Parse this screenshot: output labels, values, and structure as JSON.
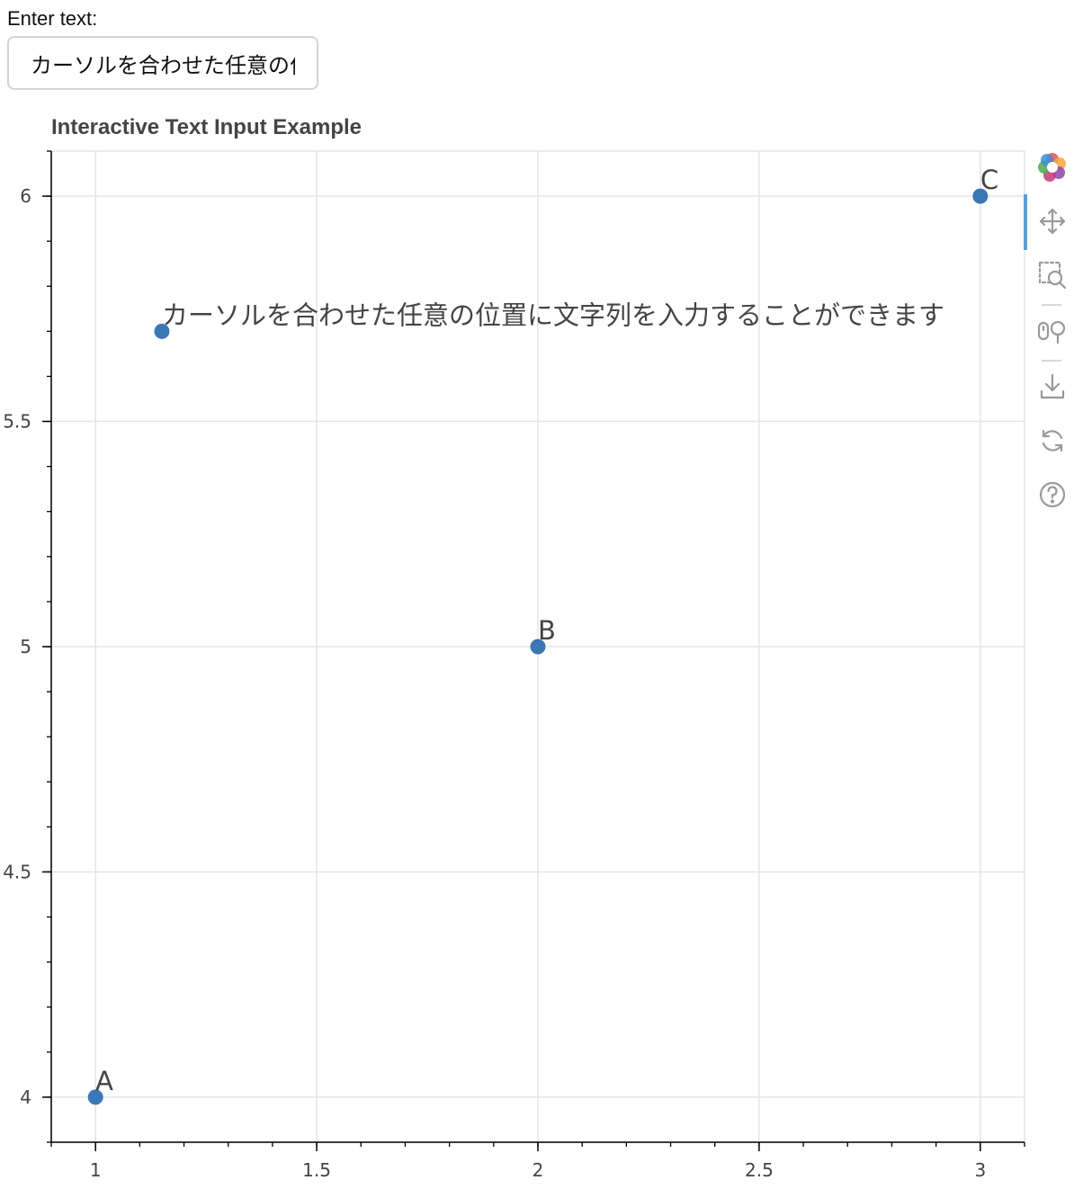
{
  "input": {
    "label": "Enter text:",
    "value": "カーソルを合わせた任意の位置に文字列を入力することができます"
  },
  "toolbar": {
    "tools": [
      {
        "name": "bokeh-logo-icon"
      },
      {
        "name": "pan-tool-icon"
      },
      {
        "name": "box-zoom-tool-icon"
      },
      {
        "name": "wheel-zoom-tool-icon"
      },
      {
        "name": "save-tool-icon"
      },
      {
        "name": "reset-tool-icon"
      },
      {
        "name": "help-tool-icon"
      }
    ],
    "active_color": "#5a9fd6"
  },
  "chart_data": {
    "type": "scatter",
    "title": "Interactive Text Input Example",
    "xlabel": "",
    "ylabel": "",
    "xlim": [
      0.9,
      3.1
    ],
    "ylim": [
      3.9,
      6.1
    ],
    "x_ticks": [
      1,
      1.5,
      2,
      2.5,
      3
    ],
    "x_tick_labels": [
      "1",
      "1.5",
      "2",
      "2.5",
      "3"
    ],
    "y_ticks": [
      4,
      4.5,
      5,
      5.5,
      6
    ],
    "y_tick_labels": [
      "4",
      "4.5",
      "5",
      "5.5",
      "6"
    ],
    "grid": true,
    "marker_color": "#3a78b5",
    "points": [
      {
        "x": 1,
        "y": 4,
        "label": "A"
      },
      {
        "x": 2,
        "y": 5,
        "label": "B"
      },
      {
        "x": 3,
        "y": 6,
        "label": "C"
      },
      {
        "x": 1.15,
        "y": 5.7,
        "label": "カーソルを合わせた任意の位置に文字列を入力することができます"
      }
    ]
  }
}
